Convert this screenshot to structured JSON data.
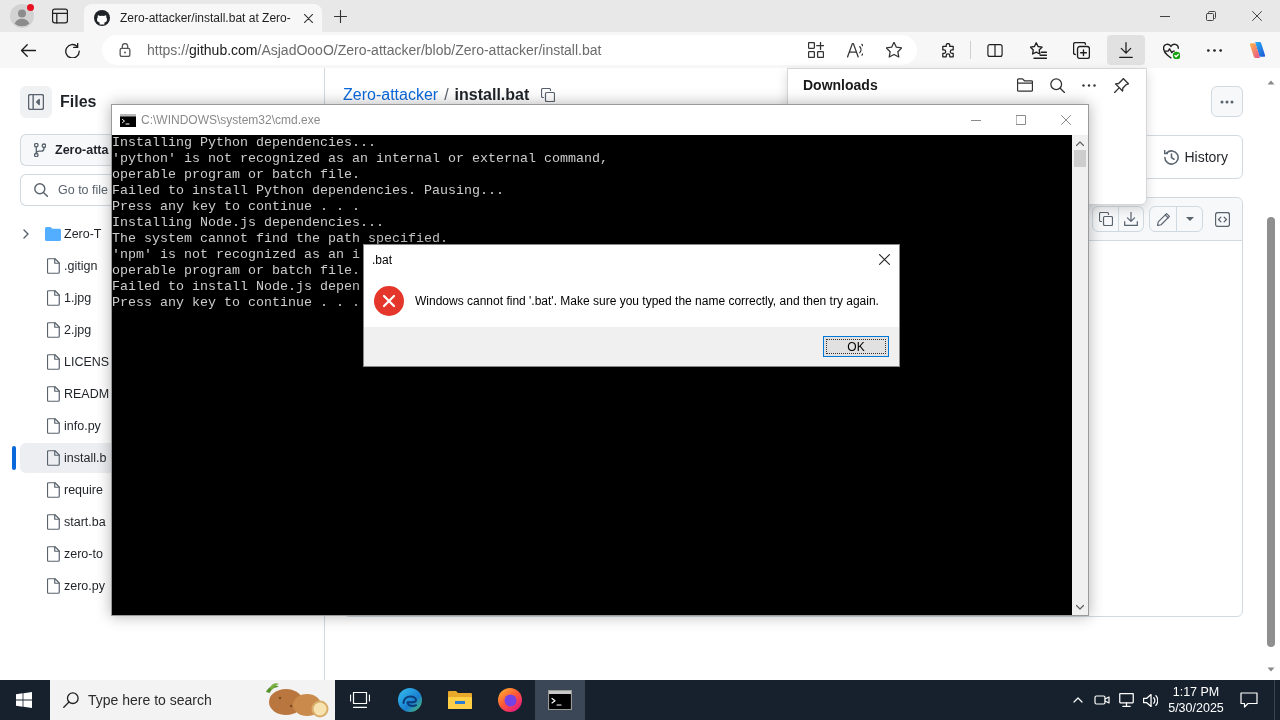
{
  "browser": {
    "profile": {
      "notification": true
    },
    "tabs": [
      {
        "title": "Zero-attacker/install.bat at Zero-",
        "selected": true
      }
    ],
    "address_bar": {
      "url": "https://github.com/AsjadOooO/Zero-attacker/blob/Zero-attacker/install.bat",
      "actions": [
        {
          "kind": "app-available"
        },
        {
          "kind": "read-aloud"
        },
        {
          "kind": "favorite"
        }
      ]
    },
    "toolbar_buttons": [
      {
        "kind": "extensions",
        "selected": false
      },
      {
        "kind": "split-screen",
        "selected": false
      },
      {
        "kind": "favorites",
        "selected": false
      },
      {
        "kind": "collections",
        "selected": false
      },
      {
        "kind": "downloads",
        "selected": true
      },
      {
        "kind": "essentials",
        "selected": false
      },
      {
        "kind": "more",
        "selected": false
      },
      {
        "kind": "assistant",
        "selected": false
      }
    ]
  },
  "downloads_panel": {
    "title": "Downloads"
  },
  "github": {
    "sidebar": {
      "title": "Files",
      "branch": "Zero-atta",
      "search": {
        "placeholder": "Go to file"
      },
      "tree": [
        {
          "kind": "folder",
          "name": "Zero-T",
          "expanded": false,
          "selected": false
        },
        {
          "kind": "file",
          "name": ".gitign",
          "selected": false
        },
        {
          "kind": "file",
          "name": "1.jpg",
          "selected": false
        },
        {
          "kind": "file",
          "name": "2.jpg",
          "selected": false
        },
        {
          "kind": "file",
          "name": "LICENS",
          "selected": false
        },
        {
          "kind": "file",
          "name": "READM",
          "selected": false
        },
        {
          "kind": "file",
          "name": "info.py",
          "selected": false
        },
        {
          "kind": "file",
          "name": "install.b",
          "selected": true
        },
        {
          "kind": "file",
          "name": "require",
          "selected": false
        },
        {
          "kind": "file",
          "name": "start.ba",
          "selected": false
        },
        {
          "kind": "file",
          "name": "zero-to",
          "selected": false
        },
        {
          "kind": "file",
          "name": "zero.py",
          "selected": false
        }
      ]
    },
    "breadcrumb": {
      "repo": "Zero-attacker",
      "separator": "/",
      "file": "install.bat"
    },
    "latest_commit": {
      "history": "History"
    }
  },
  "cmd_window": {
    "title": "C:\\WINDOWS\\system32\\cmd.exe",
    "active": false,
    "lines": [
      "Installing Python dependencies...",
      "'python' is not recognized as an internal or external command,",
      "operable program or batch file.",
      "Failed to install Python dependencies. Pausing...",
      "Press any key to continue . . .",
      "Installing Node.js dependencies...",
      "The system cannot find the path specified.",
      "'npm' is not recognized as an i",
      "operable program or batch file.",
      "Failed to install Node.js depen",
      "Press any key to continue . . ."
    ]
  },
  "dialog": {
    "title": ".bat",
    "active": true,
    "message": "Windows cannot find '.bat'. Make sure you typed the name correctly, and then try again.",
    "buttons": [
      {
        "label": "OK",
        "default": true
      }
    ]
  },
  "taskbar": {
    "search": {
      "placeholder": "Type here to search"
    },
    "apps": [
      {
        "kind": "task-view",
        "selected": false
      },
      {
        "kind": "edge-browser",
        "selected": false
      },
      {
        "kind": "file-explorer",
        "selected": false
      },
      {
        "kind": "firefox-browser",
        "selected": false
      },
      {
        "kind": "command-prompt",
        "selected": true
      }
    ],
    "clock": {
      "time": "1:17 PM",
      "date": "5/30/2025"
    }
  }
}
